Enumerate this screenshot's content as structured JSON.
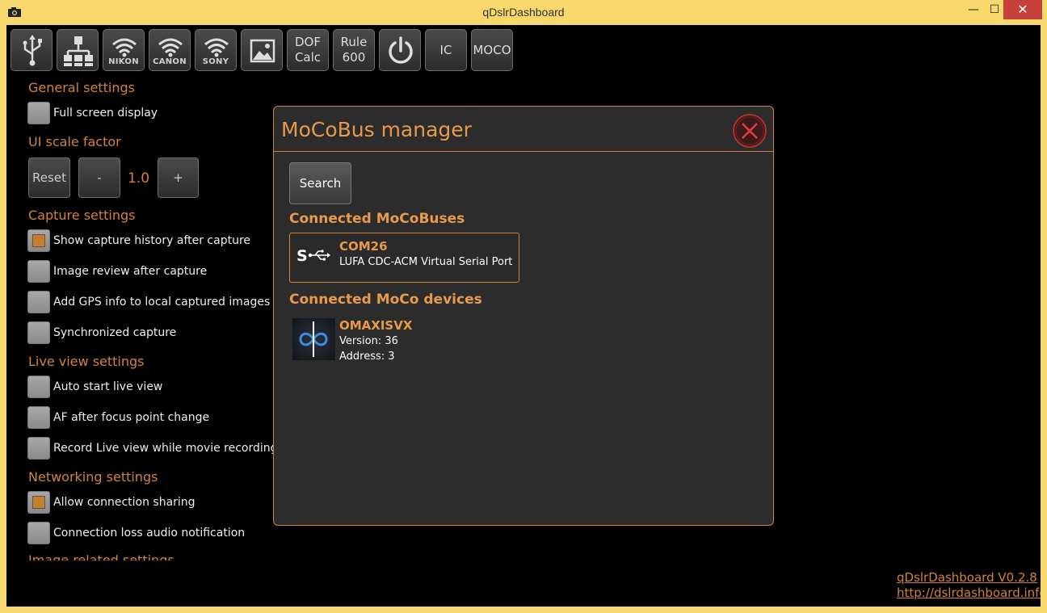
{
  "window": {
    "title": "qDslrDashboard",
    "min_glyph": "—",
    "max_glyph": "☐",
    "close_glyph": "✕"
  },
  "toolbar": {
    "usb_icon": "usb-icon",
    "network_icon": "network-icon",
    "nikon_label": "NIKON",
    "canon_label": "CANON",
    "sony_label": "SONY",
    "gallery_icon": "image-icon",
    "dof_label": "DOF\nCalc",
    "rule_label": "Rule\n600",
    "power_icon": "power-icon",
    "ic_label": "IC",
    "moco_label": "MOCO"
  },
  "settings": {
    "general_title": "General settings",
    "full_screen": "Full screen display",
    "ui_scale_title": "UI scale factor",
    "reset_label": "Reset",
    "minus_label": "-",
    "scale_value": "1.0",
    "plus_label": "+",
    "capture_title": "Capture settings",
    "show_history": "Show capture history after capture",
    "image_review": "Image review after capture",
    "add_gps": "Add GPS info to local captured images",
    "sync_capture": "Synchronized capture",
    "liveview_title": "Live view settings",
    "auto_start": "Auto start live view",
    "af_after": "AF after focus point change",
    "record_lv": "Record Live view while movie recording",
    "networking_title": "Networking settings",
    "allow_sharing": "Allow connection sharing",
    "conn_loss": "Connection loss audio notification",
    "image_related_title": "Image related settings"
  },
  "dialog": {
    "title": "MoCoBus manager",
    "search_label": "Search",
    "connected_buses_title": "Connected MoCoBuses",
    "bus_name": "COM26",
    "bus_desc": "LUFA CDC-ACM Virtual Serial Port",
    "bus_icon_text": "S",
    "connected_devices_title": "Connected MoCo devices",
    "device_name": "OMAXISVX",
    "device_version": "Version: 36",
    "device_address": "Address: 3"
  },
  "footer": {
    "version": "qDslrDashboard V0.2.8",
    "url": "http://dslrdashboard.info"
  },
  "colors": {
    "accent": "#d3823c",
    "titlebar": "#f6d86d",
    "close": "#c7403a"
  }
}
